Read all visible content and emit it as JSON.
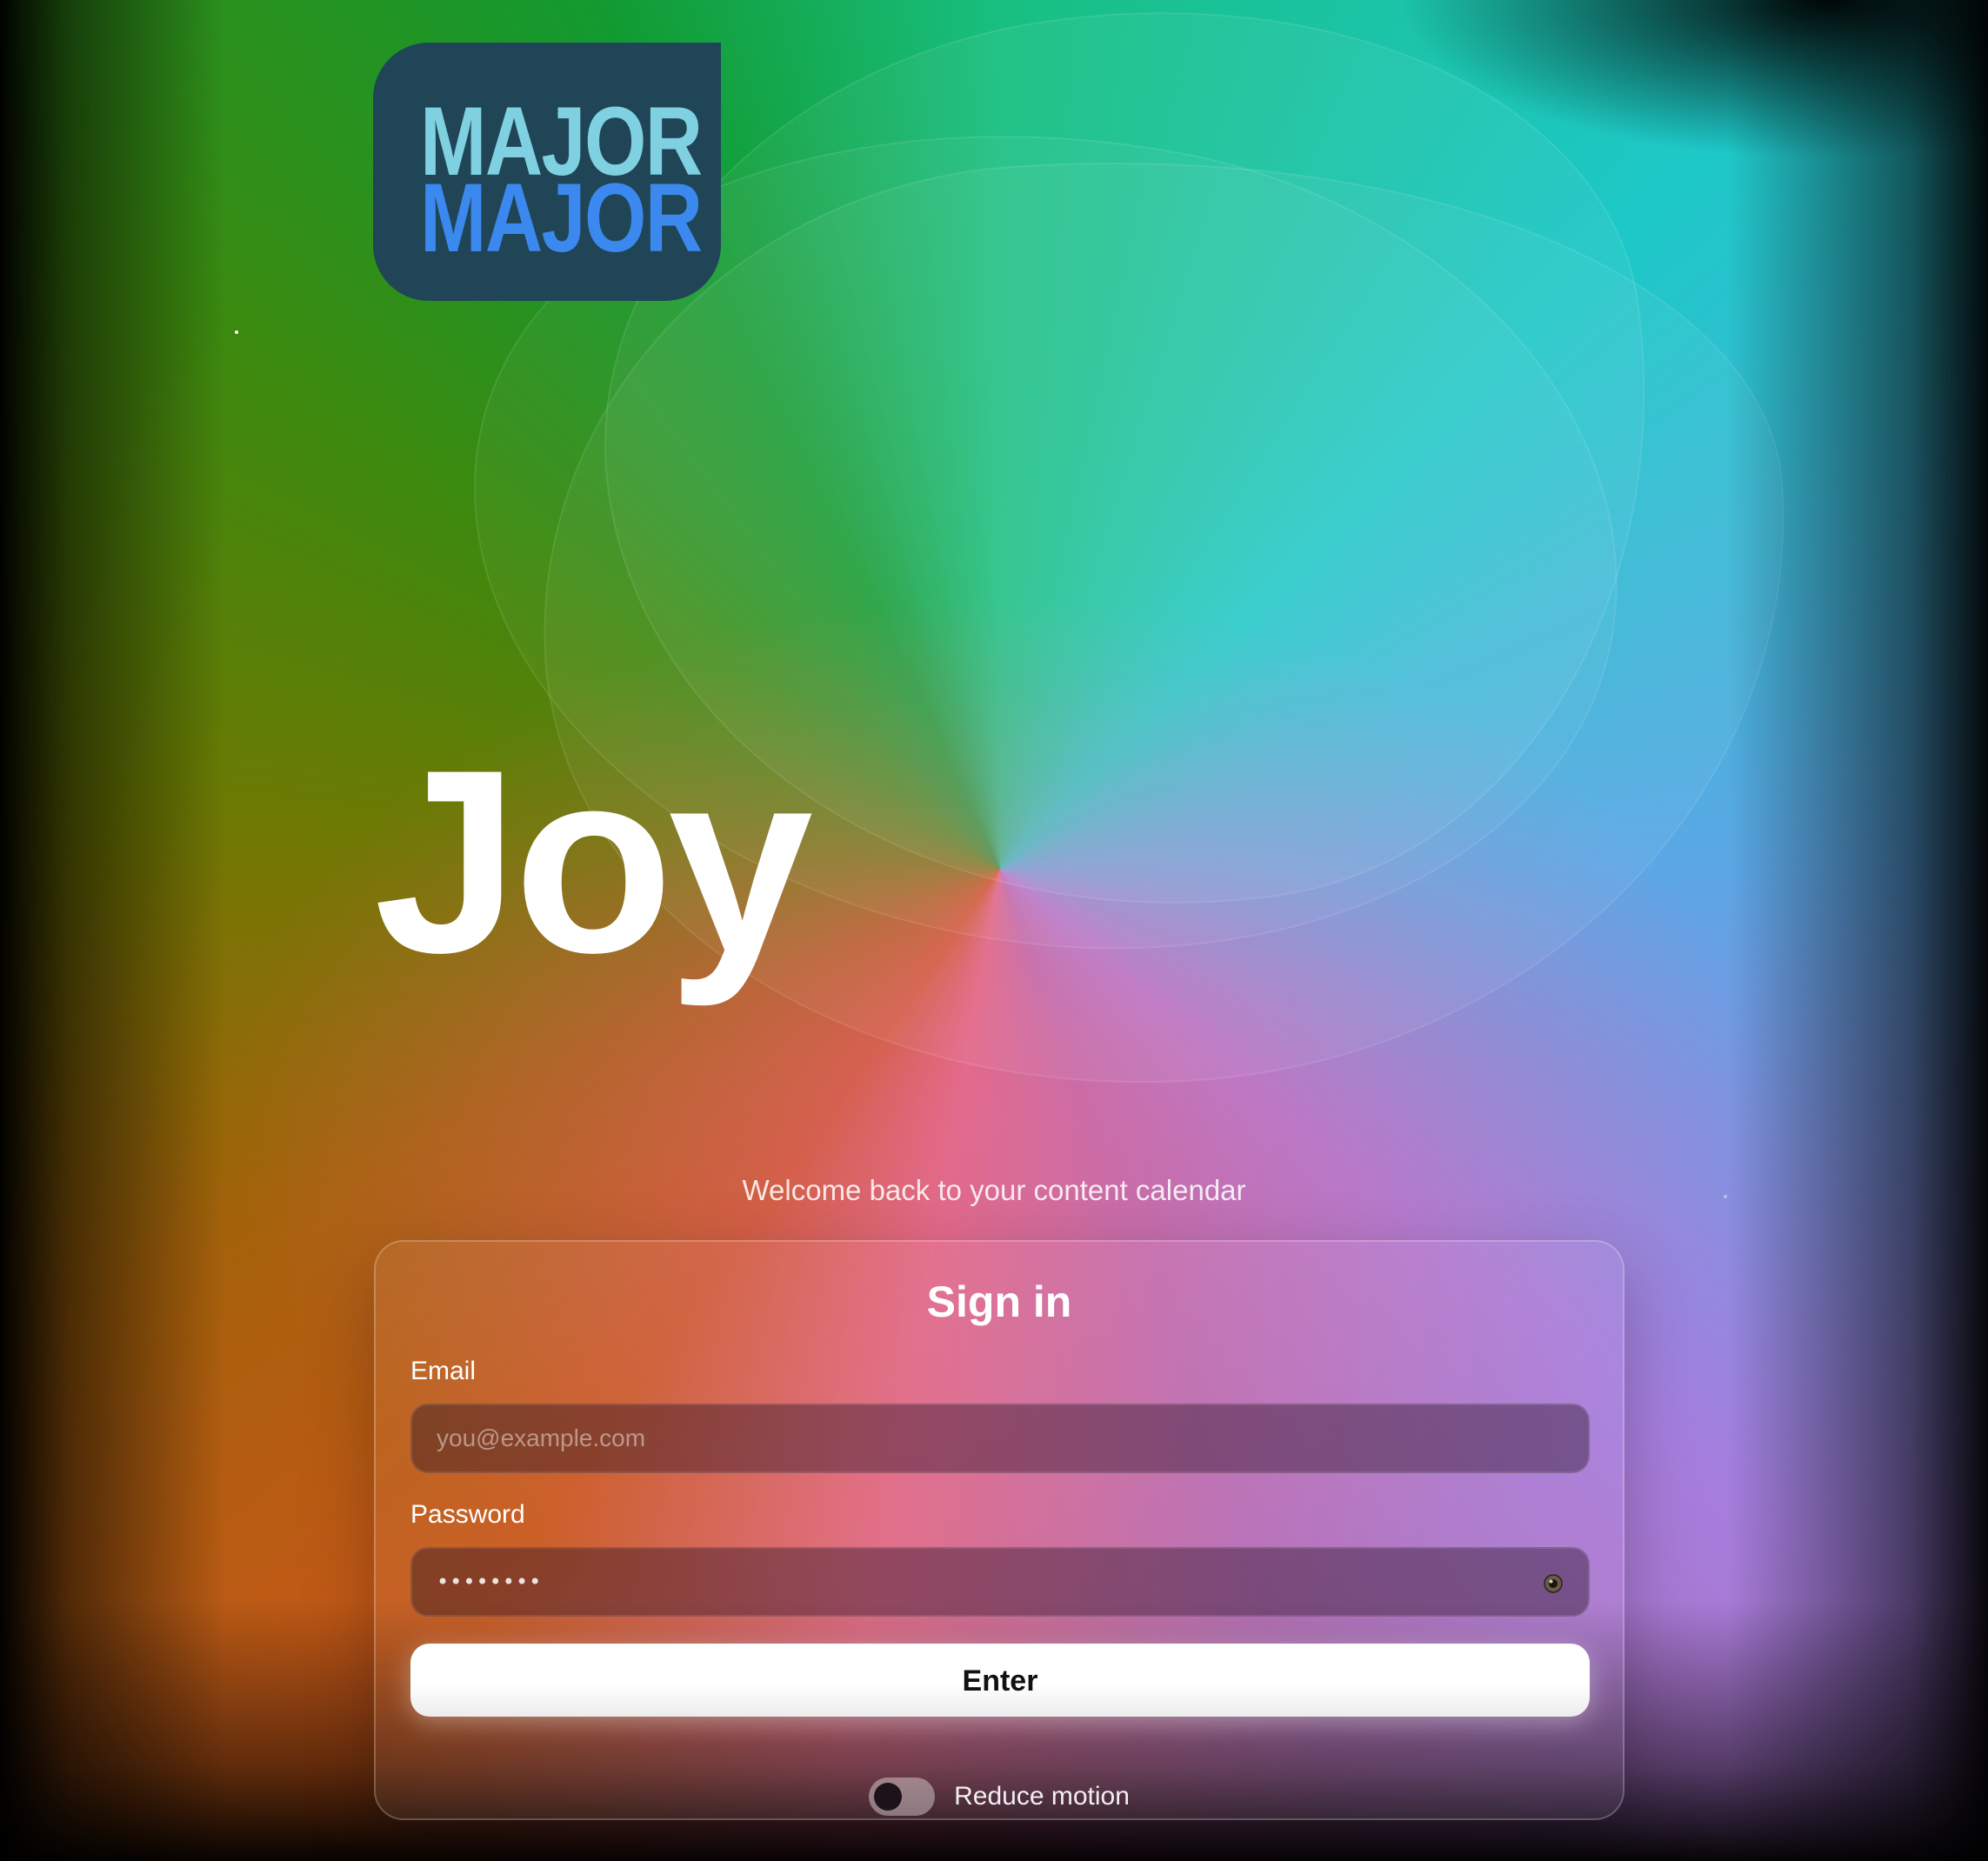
{
  "brand": {
    "logo_line1": "MAJOR",
    "logo_line2": "MAJOR"
  },
  "hero": {
    "title": "Joy",
    "subtitle": "Welcome back to your content calendar"
  },
  "signin": {
    "title": "Sign in",
    "email_label": "Email",
    "email_placeholder": "you@example.com",
    "email_value": "",
    "password_label": "Password",
    "password_value": "••••••••",
    "submit_label": "Enter",
    "reduce_motion_label": "Reduce motion",
    "reduce_motion_enabled": false
  },
  "icons": {
    "password_toggle": "eye-icon"
  },
  "colors": {
    "logo_tile": "#1f4557",
    "logo_top": "#7fd0e0",
    "logo_bottom": "#3b89ee",
    "button_bg": "#ffffff",
    "button_text": "#111111"
  }
}
